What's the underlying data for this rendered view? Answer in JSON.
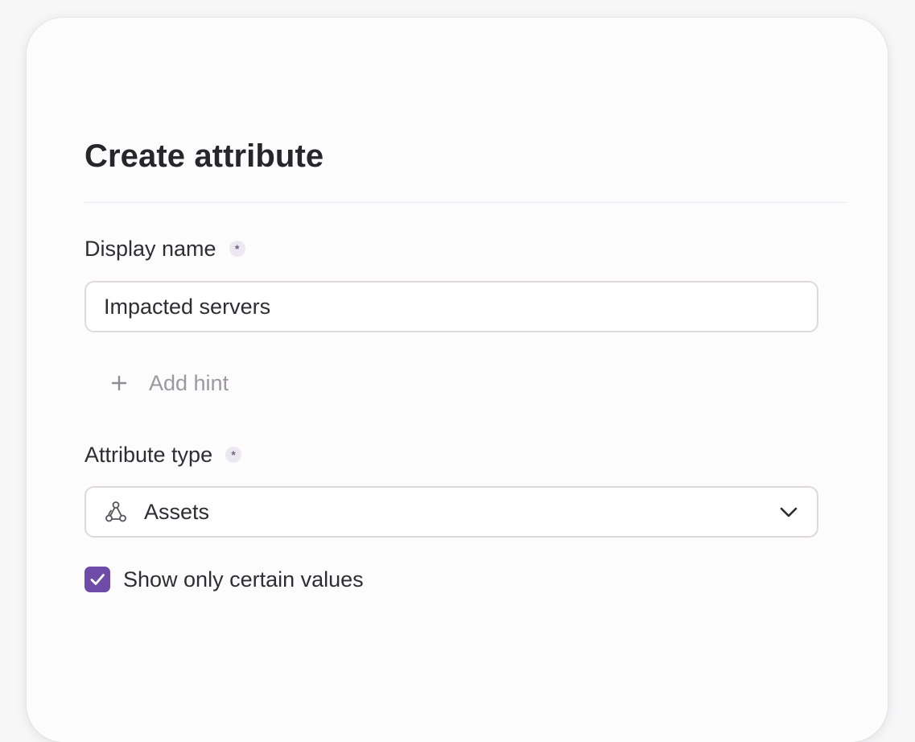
{
  "dialog": {
    "title": "Create attribute",
    "display_name": {
      "label": "Display name",
      "required_marker": "*",
      "value": "Impacted servers"
    },
    "add_hint_label": "Add hint",
    "attribute_type": {
      "label": "Attribute type",
      "required_marker": "*",
      "selected": "Assets",
      "icon": "assets-icon"
    },
    "show_certain_values": {
      "label": "Show only certain values",
      "checked": true
    }
  },
  "colors": {
    "accent": "#6e4ba6",
    "text": "#2d2d33",
    "muted": "#9a98a0",
    "border": "#dcdadf"
  }
}
